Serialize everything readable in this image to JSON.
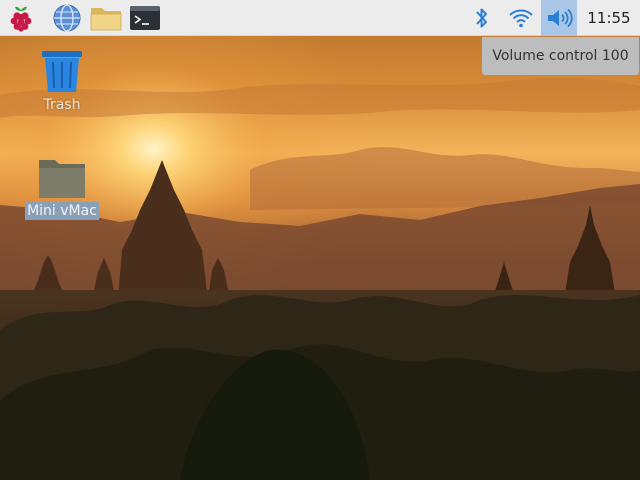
{
  "taskbar": {
    "launchers": [
      {
        "name": "raspberry-menu-icon"
      },
      {
        "name": "web-browser-icon"
      },
      {
        "name": "file-manager-icon"
      },
      {
        "name": "terminal-icon"
      }
    ],
    "tray": {
      "bluetooth": "bluetooth-icon",
      "wifi": "wifi-icon",
      "volume": "volume-icon",
      "volume_active_bg": "#a9c6e6"
    },
    "clock": "11:55"
  },
  "tooltip": {
    "text": "Volume control 100"
  },
  "desktop": {
    "icons": [
      {
        "label": "Trash",
        "icon": "trash-icon",
        "selected": false
      },
      {
        "label": "Mini vMac",
        "icon": "folder-icon",
        "selected": true
      }
    ]
  },
  "colors": {
    "taskbar_bg": "#ececec",
    "accent": "#2a7fd4",
    "selection": "#8aa0b8"
  }
}
